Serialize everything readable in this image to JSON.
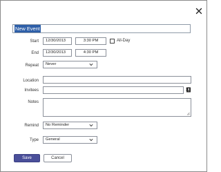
{
  "event": {
    "title_value": "New Event",
    "start": {
      "label": "Start",
      "date": "12/30/2013",
      "time": "3:30 PM"
    },
    "end": {
      "label": "End",
      "date": "12/30/2013",
      "time": "4:30 PM"
    },
    "all_day": {
      "label": "All-Day",
      "checked": false
    },
    "repeat": {
      "label": "Repeat",
      "value": "Never"
    },
    "location": {
      "label": "Location",
      "value": ""
    },
    "invitees": {
      "label": "Invitees",
      "value": ""
    },
    "notes": {
      "label": "Notes",
      "value": ""
    },
    "remind": {
      "label": "Remind",
      "value": "No Reminder"
    },
    "type": {
      "label": "Type",
      "value": "General"
    }
  },
  "buttons": {
    "save": "Save",
    "cancel": "Cancel"
  },
  "icons": {
    "close": "close-icon",
    "chevron": "chevron-down-icon",
    "address_book": "address-book-icon",
    "resize": "resize-grip-icon"
  },
  "colors": {
    "save_button": "#4a4f9a",
    "title_selection": "#2e5fa8"
  }
}
